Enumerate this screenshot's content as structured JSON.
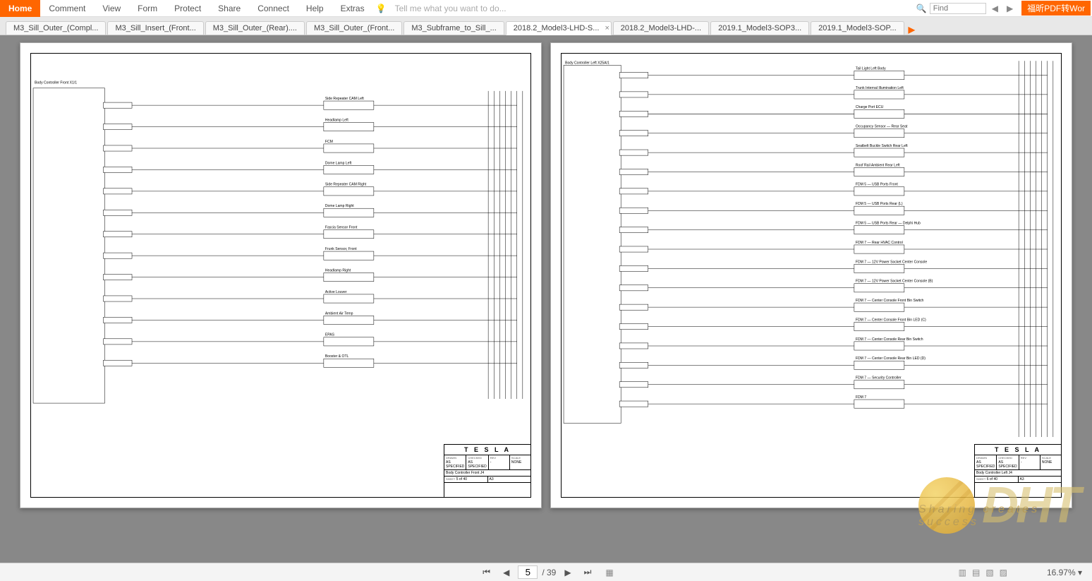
{
  "menubar": {
    "home": "Home",
    "items": [
      "Comment",
      "View",
      "Form",
      "Protect",
      "Share",
      "Connect",
      "Help",
      "Extras"
    ],
    "tellme": "Tell me what you want to do...",
    "find_placeholder": "Find",
    "orange_tag": "福昕PDF转Wor"
  },
  "doctabs": [
    {
      "label": "M3_Sill_Outer_(Compl...",
      "active": false
    },
    {
      "label": "M3_Sill_Insert_(Front...",
      "active": false
    },
    {
      "label": "M3_Sill_Outer_(Rear)....",
      "active": false
    },
    {
      "label": "M3_Sill_Outer_(Front...",
      "active": false
    },
    {
      "label": "M3_Subframe_to_Sill_...",
      "active": false
    },
    {
      "label": "2018.2_Model3-LHD-S...",
      "active": true
    },
    {
      "label": "2018.2_Model3-LHD-...",
      "active": false
    },
    {
      "label": "2019.1_Model3-SOP3...",
      "active": false
    },
    {
      "label": "2019.1_Model3-SOP...",
      "active": false
    }
  ],
  "pages": {
    "page_left": {
      "header": "Body Controller Front\nX1/1",
      "brand": "T E S L A",
      "drawn": "AS SPECIFIED",
      "checked": "AS SPECIFIED",
      "rev": "-",
      "scale": "NONE",
      "title": "Body Controller Front J4",
      "sheet": "5 of 40",
      "size": "A3",
      "components": [
        "Side Repeater CAM Left",
        "Headlamp Left",
        "FCM",
        "Dome Lamp Left",
        "Side Repeater CAM Right",
        "Dome Lamp Right",
        "Fascia Sensor Front",
        "Frunk Sensor, Front",
        "Headlamp Right",
        "Active Louver",
        "Ambient Air Temp",
        "EPAS",
        "Booster & OTL"
      ]
    },
    "page_right": {
      "header": "Body Controller Left\nX25A/1",
      "brand": "T E S L A",
      "drawn": "AS SPECIFIED",
      "checked": "AS SPECIFIED",
      "rev": "-",
      "scale": "NONE",
      "title": "Body Controller Left J4",
      "sheet": "6 of 40",
      "size": "A3",
      "components": [
        "Tail Light Left Body",
        "Trunk Internal Illumination Left",
        "Charge Port ECU",
        "Occupancy Sensor — Rear Seat",
        "Seatbelt Buckle Switch Rear Left",
        "Roof Rail Ambient Rear Left",
        "FDM 5 — USB Ports Front",
        "FDM 5 — USB Ports Rear (L)",
        "FDM 5 — USB Ports Rear — Delphi Hub",
        "FDM 7 — Rear HVAC Control",
        "FDM 7 — 12V Power Socket Center Console",
        "FDM 7 — 12V Power Socket Center Console (B)",
        "FDM 7 — Center Console Front Bin Switch",
        "FDM 7 — Center Console Front Bin LED (C)",
        "FDM 7 — Center Console Rear Bin Switch",
        "FDM 7 — Center Console Rear Bin LED (D)",
        "FDM 7 — Security Controller",
        "FDM 7"
      ]
    }
  },
  "statusbar": {
    "current_page": "5",
    "total_pages": "39",
    "zoom": "16.97%"
  },
  "watermark": {
    "logo": "DHT",
    "tagline": "Sharing creates success"
  }
}
